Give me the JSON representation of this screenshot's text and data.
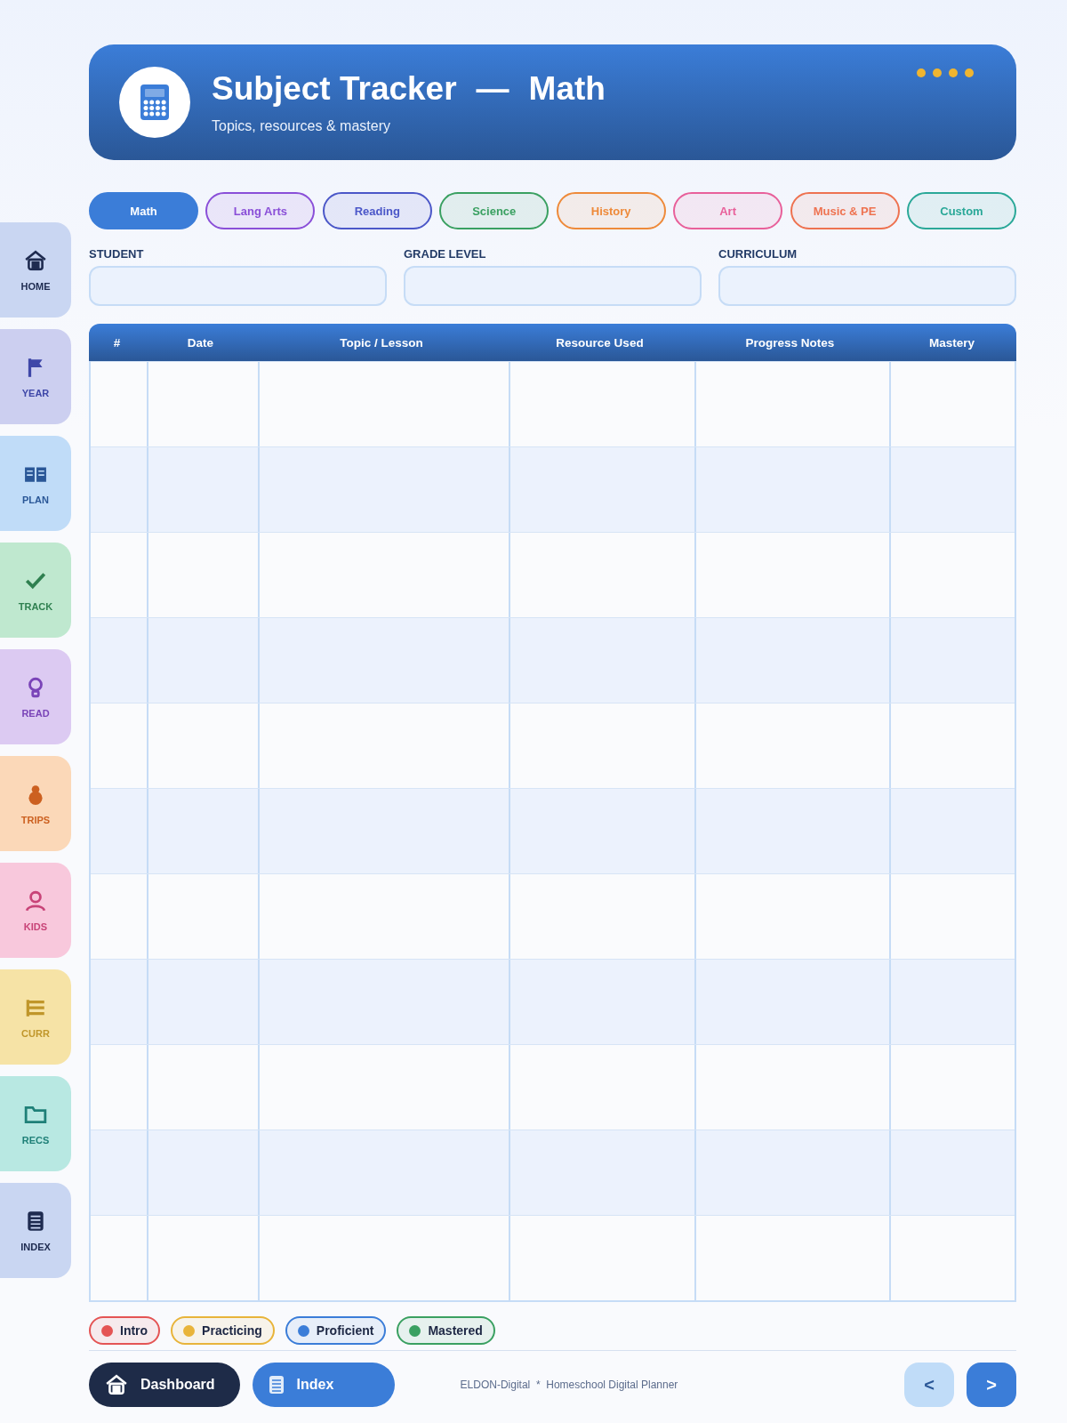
{
  "header": {
    "title": "Subject Tracker",
    "separator": "—",
    "subject": "Math",
    "subtitle": "Topics, resources & mastery"
  },
  "sidebar": {
    "items": [
      {
        "label": "HOME",
        "color": "#c9d6f2"
      },
      {
        "label": "YEAR",
        "color": "#cccff0"
      },
      {
        "label": "PLAN",
        "color": "#c0dcf8"
      },
      {
        "label": "TRACK",
        "color": "#bfe8cf"
      },
      {
        "label": "READ",
        "color": "#dccaf2"
      },
      {
        "label": "TRIPS",
        "color": "#fbd8b8"
      },
      {
        "label": "KIDS",
        "color": "#f8c8dc"
      },
      {
        "label": "CURR",
        "color": "#f6e3a6"
      },
      {
        "label": "RECS",
        "color": "#b8e8e2"
      },
      {
        "label": "INDEX",
        "color": "#c9d6f2"
      }
    ]
  },
  "tabs": [
    {
      "label": "Math",
      "selected": true,
      "color": "#3b7dd8"
    },
    {
      "label": "Lang Arts",
      "selected": false,
      "color": "#8a4fd8"
    },
    {
      "label": "Reading",
      "selected": false,
      "color": "#4b57c8"
    },
    {
      "label": "Science",
      "selected": false,
      "color": "#3aa061"
    },
    {
      "label": "History",
      "selected": false,
      "color": "#ee8a3a"
    },
    {
      "label": "Art",
      "selected": false,
      "color": "#e8609a"
    },
    {
      "label": "Music & PE",
      "selected": false,
      "color": "#ee7250"
    },
    {
      "label": "Custom",
      "selected": false,
      "color": "#2aa898"
    }
  ],
  "fields": [
    {
      "label": "STUDENT"
    },
    {
      "label": "GRADE LEVEL"
    },
    {
      "label": "CURRICULUM"
    }
  ],
  "table": {
    "columns": [
      "#",
      "Date",
      "Topic / Lesson",
      "Resource Used",
      "Progress Notes",
      "Mastery"
    ]
  },
  "legend": [
    {
      "label": "Intro",
      "color": "#e45454"
    },
    {
      "label": "Practicing",
      "color": "#e8b43a"
    },
    {
      "label": "Proficient",
      "color": "#3b7dd8"
    },
    {
      "label": "Mastered",
      "color": "#3aa061"
    }
  ],
  "footer": {
    "dashboard": "Dashboard",
    "index": "Index",
    "credit": "ELDON-Digital  *  Homeschool Digital Planner",
    "prev": "<",
    "next": ">"
  }
}
